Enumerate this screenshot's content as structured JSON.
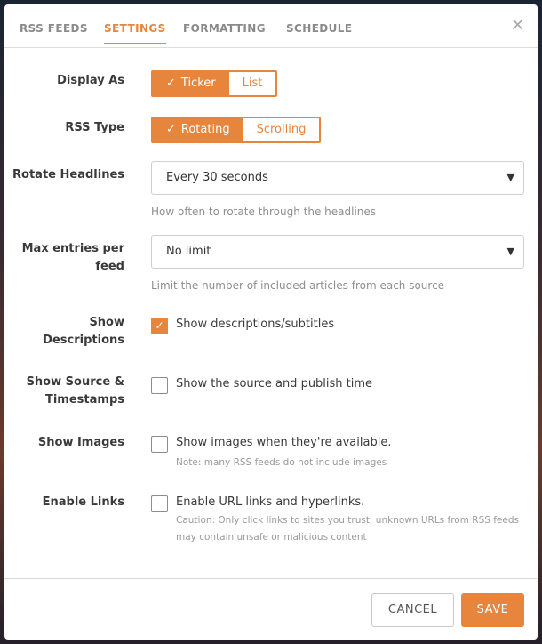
{
  "tabs": [
    "RSS FEEDS",
    "SETTINGS",
    "FORMATTING",
    "SCHEDULE"
  ],
  "close_glyph": "×",
  "display_as": {
    "label": "Display As",
    "options": [
      "Ticker",
      "List"
    ],
    "selected": "Ticker"
  },
  "rss_type": {
    "label": "RSS Type",
    "options": [
      "Rotating",
      "Scrolling"
    ],
    "selected": "Rotating"
  },
  "rotate": {
    "label": "Rotate Headlines",
    "value": "Every 30 seconds",
    "help": "How often to rotate through the headlines"
  },
  "max_entries": {
    "label_line1": "Max entries per",
    "label_line2": "feed",
    "value": "No limit",
    "help": "Limit the number of included articles from each source"
  },
  "show_descriptions": {
    "label_line1": "Show",
    "label_line2": "Descriptions",
    "text": "Show descriptions/subtitles",
    "checked": true
  },
  "show_source": {
    "label_line1": "Show Source &",
    "label_line2": "Timestamps",
    "text": "Show the source and publish time",
    "checked": false
  },
  "show_images": {
    "label": "Show Images",
    "text": "Show images when they're available.",
    "note": "Note: many RSS feeds do not include images",
    "checked": false
  },
  "enable_links": {
    "label": "Enable Links",
    "text": "Enable URL links and hyperlinks.",
    "note": "Caution: Only click links to sites you trust; unknown URLs from RSS feeds may contain unsafe or malicious content",
    "checked": false
  },
  "footer": {
    "cancel": "CANCEL",
    "save": "SAVE"
  },
  "colors": {
    "accent": "#e8853d"
  },
  "icons": {
    "check": "check-icon",
    "caret": "chevron-down-icon",
    "close": "close-icon"
  }
}
